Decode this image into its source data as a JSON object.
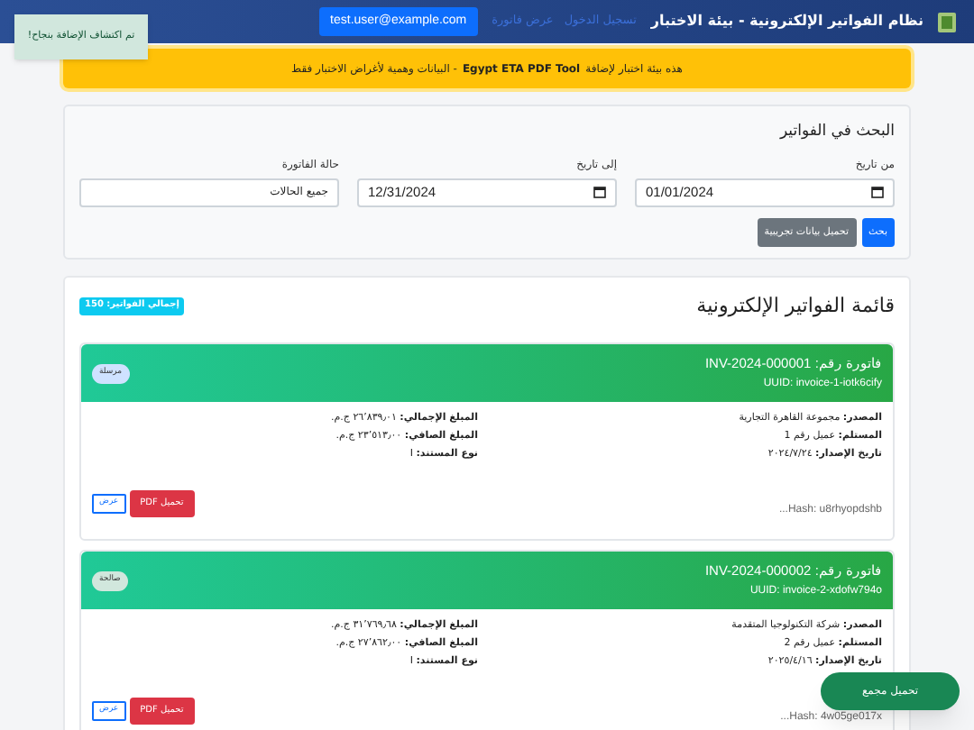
{
  "header": {
    "brand": "نظام الفواتير الإلكترونية - بيئة الاختبار",
    "nav_links": [
      "تسجيل الدخول",
      "عرض فاتورة"
    ],
    "user": "test.user@example.com"
  },
  "toast": "تم اكتشاف الإضافة بنجاح!",
  "banner": "هذه بيئة اختبار لإضافة **Egypt ETA PDF Tool** - البيانات وهمية لأغراض الاختبار فقط",
  "search": {
    "title": "البحث في الفواتير",
    "fields": [
      {
        "kind": "date",
        "label": "من تاريخ",
        "value": "01/01/2024"
      },
      {
        "kind": "date",
        "label": "إلى تاريخ",
        "value": "12/31/2024"
      },
      {
        "kind": "select",
        "label": "حالة الفاتورة",
        "value": "جميع الحالات"
      }
    ],
    "buttons": [
      {
        "kind": "primary",
        "label": "بحث"
      },
      {
        "kind": "secondary",
        "label": "تحميل بيانات تجريبية"
      }
    ]
  },
  "list": {
    "title": "قائمة الفواتير الإلكترونية",
    "total_badge": "إجمالي الفواتير: 150",
    "invoices": [
      {
        "number": "فاتورة رقم: INV-2024-000001",
        "uuid": "UUID: invoice-1-iotk6cify",
        "status": "مرسلة",
        "color": "#cfe2ff",
        "left": [
          "**المصدر:** مجموعة القاهرة التجارية",
          "**المستلم:** عميل رقم 1",
          "**تاريخ الإصدار:** ٢٠٢٤/٧/٢٤"
        ],
        "right": [
          "**المبلغ الإجمالي:** ٢٦٬٨٣٩٫٠١ ج.م.",
          "**المبلغ الصافي:** ٢٣٬٥١٣٫٠٠ ج.م.",
          "**نوع المستند:** I"
        ],
        "hash": "Hash: u8rhyopdshb...",
        "buttons": [
          "تحميل PDF",
          "عرض"
        ]
      },
      {
        "number": "فاتورة رقم: INV-2024-000002",
        "uuid": "UUID: invoice-2-xdofw794o",
        "status": "صالحة",
        "color": "#d1e7dd",
        "left": [
          "**المصدر:** شركة التكنولوجيا المتقدمة",
          "**المستلم:** عميل رقم 2",
          "**تاريخ الإصدار:** ٢٠٢٥/٤/١٦"
        ],
        "right": [
          "**المبلغ الإجمالي:** ٣١٬٧٦٩٫٦٨ ج.م.",
          "**المبلغ الصافي:** ٢٧٬٨٦٢٫٠٠ ج.م.",
          "**نوع المستند:** I"
        ],
        "hash": "Hash: 4w05ge017x...",
        "buttons": [
          "تحميل PDF",
          "عرض"
        ]
      }
    ]
  },
  "float_button": "تحميل مجمع"
}
